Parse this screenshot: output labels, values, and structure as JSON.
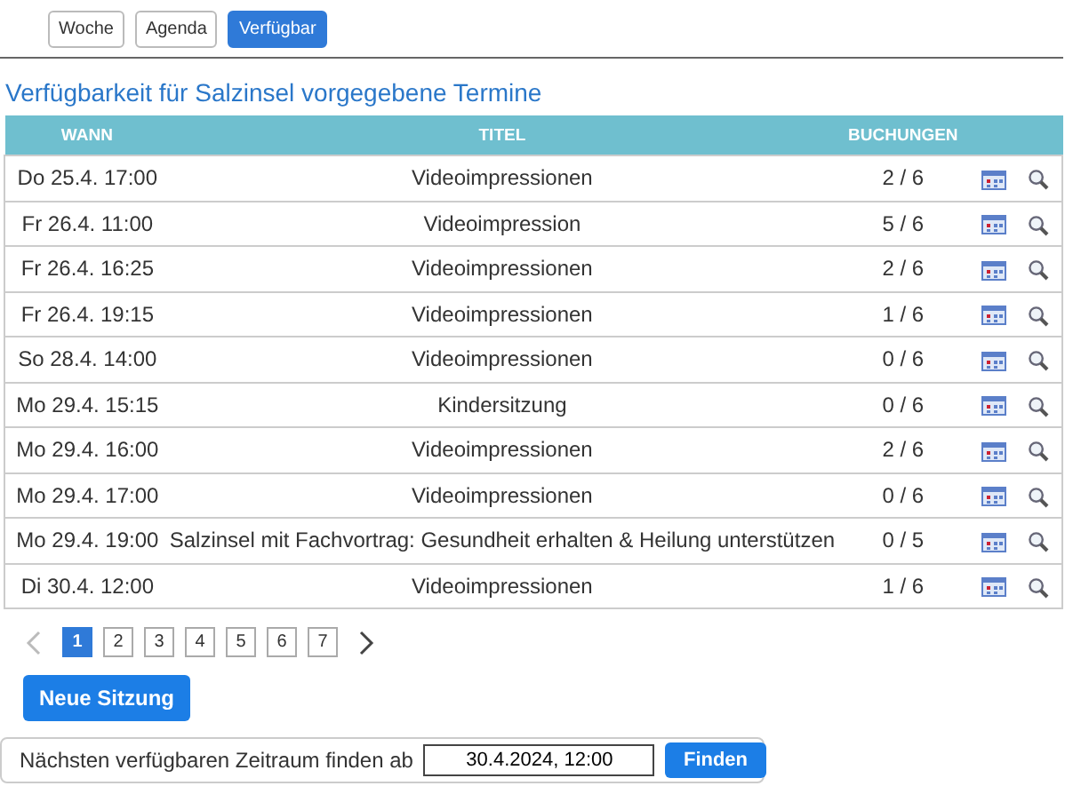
{
  "view_tabs": [
    {
      "label": "Woche",
      "selected": false
    },
    {
      "label": "Agenda",
      "selected": false
    },
    {
      "label": "Verfügbar",
      "selected": true
    }
  ],
  "heading": "Verfügbarkeit für Salzinsel vorgegebene Termine",
  "table": {
    "columns": [
      "WANN",
      "TITEL",
      "BUCHUNGEN"
    ],
    "rows": [
      {
        "when": "Do 25.4. 17:00",
        "title": "Videoimpressionen",
        "bookings": "2 / 6"
      },
      {
        "when": "Fr 26.4. 11:00",
        "title": "Videoimpression",
        "bookings": "5 / 6"
      },
      {
        "when": "Fr 26.4. 16:25",
        "title": "Videoimpressionen",
        "bookings": "2 / 6"
      },
      {
        "when": "Fr 26.4. 19:15",
        "title": "Videoimpressionen",
        "bookings": "1 / 6"
      },
      {
        "when": "So 28.4. 14:00",
        "title": "Videoimpressionen",
        "bookings": "0 / 6"
      },
      {
        "when": "Mo 29.4. 15:15",
        "title": "Kindersitzung",
        "bookings": "0 / 6"
      },
      {
        "when": "Mo 29.4. 16:00",
        "title": "Videoimpressionen",
        "bookings": "2 / 6"
      },
      {
        "when": "Mo 29.4. 17:00",
        "title": "Videoimpressionen",
        "bookings": "0 / 6"
      },
      {
        "when": "Mo 29.4. 19:00",
        "title": "Salzinsel mit Fachvortrag: Gesundheit erhalten & Heilung unterstützen",
        "bookings": "0 / 5"
      },
      {
        "when": "Di 30.4. 12:00",
        "title": "Videoimpressionen",
        "bookings": "1 / 6"
      }
    ]
  },
  "pagination": {
    "prev_disabled": true,
    "pages": [
      {
        "label": "1",
        "selected": true
      },
      {
        "label": "2",
        "selected": false
      },
      {
        "label": "3",
        "selected": false
      },
      {
        "label": "4",
        "selected": false
      },
      {
        "label": "5",
        "selected": false
      },
      {
        "label": "6",
        "selected": false
      },
      {
        "label": "7",
        "selected": false
      }
    ]
  },
  "new_session_button": "Neue Sitzung",
  "find_panel": {
    "label": "Nächsten verfügbaren Zeitraum finden ab",
    "value": "30.4.2024, 12:00",
    "button": "Finden"
  }
}
